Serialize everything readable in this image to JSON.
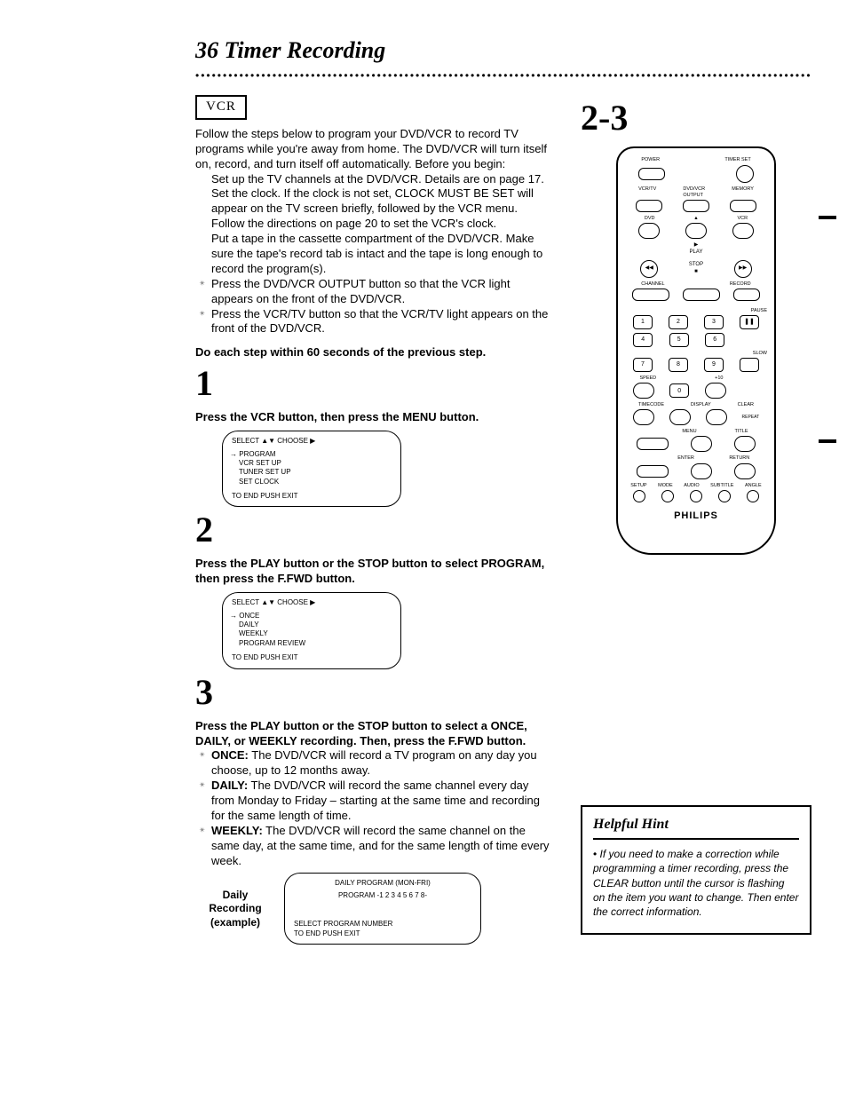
{
  "header": {
    "page_number": "36",
    "title": "Timer Recording"
  },
  "badge": "VCR",
  "right_header": "2-3",
  "intro": "Follow the steps below to program your DVD/VCR to record TV programs while you're away from home. The DVD/VCR will turn itself on, record, and turn itself off automatically. Before you begin:",
  "setup": {
    "a": "Set up the TV channels at the DVD/VCR. Details are on page 17.",
    "b": "Set the clock. If the clock is not set, CLOCK MUST BE SET will appear on the TV screen briefly, followed by the VCR menu. Follow the directions on page 20 to set the VCR's clock.",
    "c": "Put a tape in the cassette compartment of the DVD/VCR. Make sure the tape's record tab is intact and the tape is long enough to record the program(s).",
    "d": "Press the DVD/VCR OUTPUT button so that the VCR light appears on the front of the DVD/VCR.",
    "e": "Press the VCR/TV button so that the VCR/TV light appears on the front of the DVD/VCR."
  },
  "note_60": "Do each step within 60 seconds of the previous step.",
  "step1": {
    "num": "1",
    "text": "Press the VCR button, then press the MENU button."
  },
  "screen1": {
    "header": "SELECT ▲▼ CHOOSE ▶",
    "items": [
      "PROGRAM",
      "VCR SET UP",
      "TUNER SET UP",
      "SET CLOCK"
    ],
    "prompt": "TO END PUSH EXIT"
  },
  "step2": {
    "num": "2",
    "text": "Press the PLAY button or the STOP button to select PROGRAM, then press the F.FWD button."
  },
  "screen2": {
    "header": "SELECT ▲▼ CHOOSE ▶",
    "items": [
      "ONCE",
      "DAILY",
      "WEEKLY",
      "PROGRAM REVIEW"
    ],
    "prompt": "TO END PUSH EXIT"
  },
  "step3": {
    "num": "3",
    "text": "Press the PLAY button or the STOP button to select a ONCE, DAILY, or WEEKLY recording. Then, press the F.FWD button.",
    "once": "ONCE: The DVD/VCR will record a TV program on any day you choose, up to 12 months away.",
    "daily": "DAILY: The DVD/VCR will record the same channel every day from Monday to Friday – starting at the same time and recording for the same length of time.",
    "weekly": "WEEKLY: The DVD/VCR will record the same channel on the same day, at the same time, and for the same length of time every week."
  },
  "daily_label": "Daily Recording (example)",
  "screen3": {
    "line1": "DAILY PROGRAM (MON-FRI)",
    "line2": "PROGRAM   -1 2 3 4 5 6 7 8-",
    "line3": "SELECT PROGRAM NUMBER",
    "line4": "TO END PUSH EXIT"
  },
  "remote": {
    "brand": "PHILIPS"
  },
  "hint": {
    "title": "Helpful Hint",
    "body": "If you need to make a correction while programming a timer recording, press the CLEAR button until the cursor is flashing on the item you want to change. Then enter the correct information."
  }
}
